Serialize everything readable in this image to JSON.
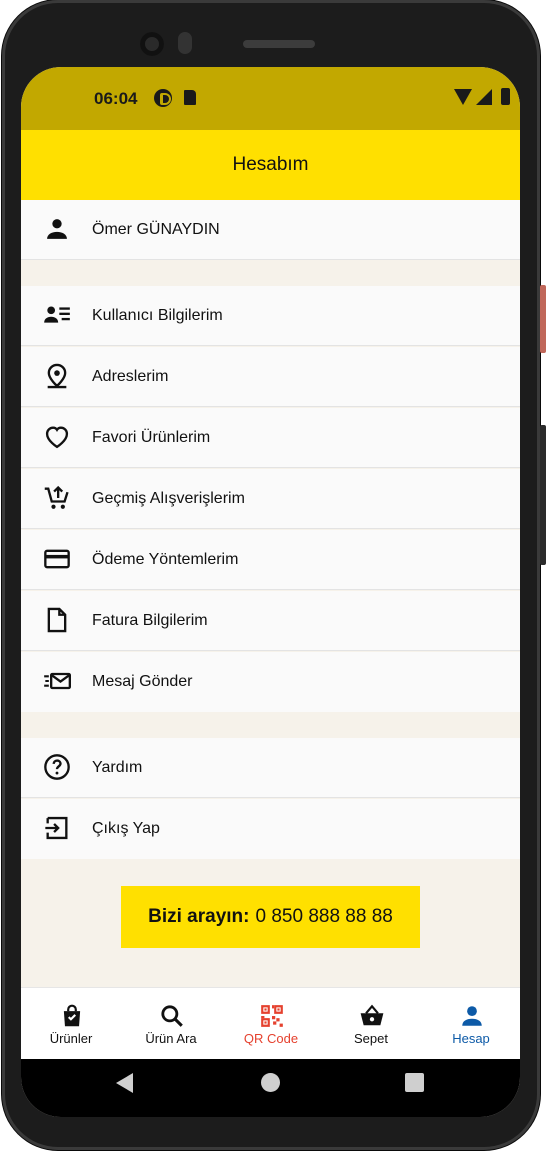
{
  "status_bar": {
    "time": "06:04"
  },
  "app_bar": {
    "title": "Hesabım"
  },
  "user": {
    "name": "Ömer GÜNAYDIN",
    "icon": "person-icon"
  },
  "menu": {
    "items": [
      {
        "label": "Kullanıcı Bilgilerim",
        "icon": "user-details-icon"
      },
      {
        "label": "Adreslerim",
        "icon": "location-pin-icon"
      },
      {
        "label": "Favori Ürünlerim",
        "icon": "heart-icon"
      },
      {
        "label": "Geçmiş Alışverişlerim",
        "icon": "cart-history-icon"
      },
      {
        "label": "Ödeme Yöntemlerim",
        "icon": "credit-card-icon"
      },
      {
        "label": "Fatura Bilgilerim",
        "icon": "document-icon"
      },
      {
        "label": "Mesaj Gönder",
        "icon": "send-mail-icon"
      }
    ]
  },
  "support": {
    "items": [
      {
        "label": "Yardım",
        "icon": "help-circle-icon"
      },
      {
        "label": "Çıkış Yap",
        "icon": "logout-icon"
      }
    ]
  },
  "call": {
    "label": "Bizi arayın:",
    "number": "0 850 888 88 88"
  },
  "bottom_nav": {
    "items": [
      {
        "label": "Ürünler",
        "icon": "shopping-bag-icon"
      },
      {
        "label": "Ürün Ara",
        "icon": "search-icon"
      },
      {
        "label": "QR Code",
        "icon": "qr-code-icon"
      },
      {
        "label": "Sepet",
        "icon": "basket-icon"
      },
      {
        "label": "Hesap",
        "icon": "person-icon"
      }
    ],
    "active": "Hesap"
  },
  "colors": {
    "status_bar": "#c2a800",
    "accent_yellow": "#ffe000",
    "page_background": "#f6f2ea",
    "qr_red": "#e5412e",
    "active_blue": "#0d5aa7"
  }
}
